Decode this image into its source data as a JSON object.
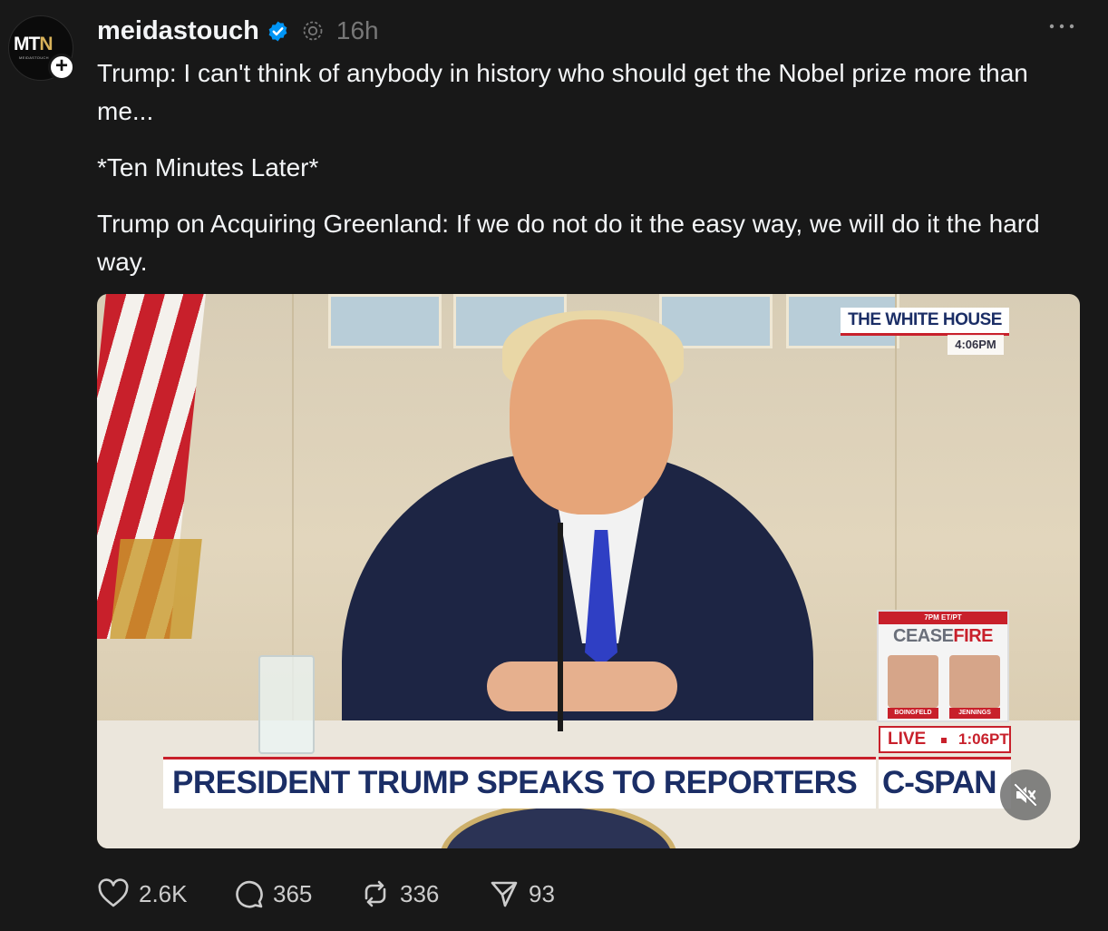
{
  "post": {
    "avatar": {
      "logo_text_main": "MT",
      "logo_text_accent": "N",
      "logo_subtitle": "MEIDASTOUCH"
    },
    "username": "meidastouch",
    "time": "16h",
    "paragraphs": [
      "Trump: I can't think of anybody in history who should get the Nobel prize more than me...",
      "*Ten Minutes Later*",
      "Trump on Acquiring Greenland: If we do not do it the easy way, we will do it the hard way."
    ],
    "media": {
      "bug_title": "THE WHITE HOUSE",
      "bug_time": "4:06PM",
      "promo_time": "7PM ET/PT",
      "promo_title_a": "CEASE",
      "promo_title_b": "FIRE",
      "promo_name_1": "BOINGFELD",
      "promo_name_2": "JENNINGS",
      "live_label": "LIVE",
      "live_time": "1:06PT",
      "lower_third": "PRESIDENT TRUMP SPEAKS TO REPORTERS",
      "network": "C-SPAN"
    },
    "actions": {
      "likes": "2.6K",
      "replies": "365",
      "reposts": "336",
      "shares": "93"
    }
  },
  "colors": {
    "background": "#181818",
    "text": "#f3f5f7",
    "muted": "#777777",
    "verified": "#0095f6"
  },
  "icons": [
    "verified-badge-icon",
    "threads-spin-icon",
    "more-icon",
    "heart-icon",
    "comment-icon",
    "repost-icon",
    "share-icon",
    "mute-icon",
    "follow-plus-icon"
  ]
}
